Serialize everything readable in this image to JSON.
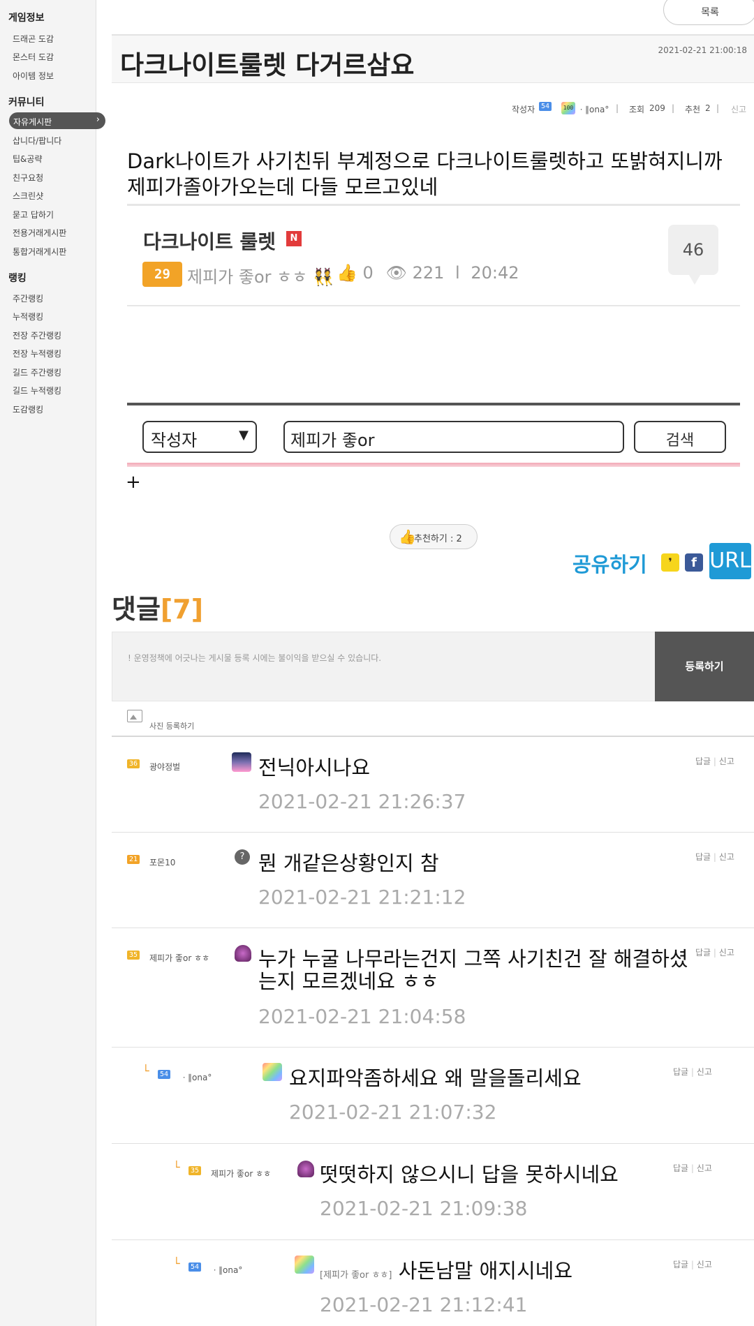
{
  "sidebar": {
    "sections": [
      {
        "heading": "게임정보",
        "items": [
          "드래곤 도감",
          "몬스터 도감",
          "아이템 정보"
        ]
      },
      {
        "heading": "커뮤니티",
        "items": [
          "자유게시판",
          "삽니다/팝니다",
          "팁&공략",
          "친구요청",
          "스크린샷",
          "묻고 답하기",
          "전용거래게시판",
          "통합거래게시판"
        ]
      },
      {
        "heading": "랭킹",
        "items": [
          "주간랭킹",
          "누적랭킹",
          "전장 주간랭킹",
          "전장 누적랭킹",
          "길드 주간랭킹",
          "길드 누적랭킹",
          "도감랭킹"
        ]
      }
    ],
    "active_item": "자유게시판"
  },
  "list_button": "목록",
  "post": {
    "title": "다크나이트룰렛 다거르삼요",
    "date": "2021-02-21 21:00:18",
    "meta": {
      "author_label": "작성자",
      "author_level": "54",
      "author_badge": "100",
      "author_name": "ㆍ∥ona°",
      "views_label": "조회",
      "views": "209",
      "recommend_label": "추천",
      "recommend": "2",
      "report": "신고"
    },
    "body": "Dark나이트가 사기친뒤 부계정으로 다크나이트룰렛하고 또밝혀지니까 제피가졸아가오는데 다들 모르고있네"
  },
  "embed": {
    "title": "다크나이트 룰렛",
    "new_badge": "N",
    "level": "29",
    "author": "제피가 좋or ㅎㅎ",
    "author_emoji": "👯",
    "likes": "0",
    "views": "221",
    "divider": "l",
    "time": "20:42",
    "comment_count": "46"
  },
  "search": {
    "select_value": "작성자",
    "input_value": "제피가 좋or",
    "button": "검색"
  },
  "plus": "+",
  "recommend_button": "추천하기 : 2",
  "share": {
    "label": "공유하기",
    "kakao": "❜",
    "facebook": "f",
    "url": "URL"
  },
  "comments": {
    "title": "댓글",
    "count_display": "[7]",
    "placeholder": "! 운영정책에 어긋나는 게시물 등록 시에는 불이익을 받으실 수 있습니다.",
    "submit": "등록하기",
    "photo_label": "사진 등록하기",
    "reply_label": "답글",
    "report_label": "신고",
    "items": [
      {
        "level": "36",
        "level_color": "#f0b429",
        "name": "광야정벌",
        "avatar": "night-city",
        "text": "전닉아시나요",
        "date": "2021-02-21 21:26:37",
        "reply_depth": 0
      },
      {
        "level": "21",
        "level_color": "#f2a327",
        "name": "포몬10",
        "avatar": "question",
        "text": "뭔 개같은상황인지 참",
        "date": "2021-02-21 21:21:12",
        "reply_depth": 0
      },
      {
        "level": "35",
        "level_color": "#f0b429",
        "name": "제피가 좋or ㅎㅎ",
        "avatar": "dragon",
        "text": "누가 누굴 나무라는건지 그쪽 사기친건 잘 해결하셨는지 모르겠네요 ㅎㅎ",
        "date": "2021-02-21 21:04:58",
        "reply_depth": 0
      },
      {
        "level": "54",
        "level_color": "#4a8ee8",
        "name": "ㆍ∥ona°",
        "avatar": "rainbow",
        "text": "요지파악좀하세요 왜 말을돌리세요",
        "date": "2021-02-21 21:07:32",
        "reply_depth": 1
      },
      {
        "level": "35",
        "level_color": "#f0b429",
        "name": "제피가 좋or ㅎㅎ",
        "avatar": "dragon",
        "text": "떳떳하지 않으시니 답을 못하시네요",
        "date": "2021-02-21 21:09:38",
        "reply_depth": 2
      },
      {
        "level": "54",
        "level_color": "#4a8ee8",
        "name": "ㆍ∥ona°",
        "avatar": "rainbow",
        "tag": "[제피가 좋or ㅎㅎ]",
        "text": "사돈남말 애지시네요",
        "date": "2021-02-21 21:12:41",
        "reply_depth": 2
      }
    ]
  }
}
